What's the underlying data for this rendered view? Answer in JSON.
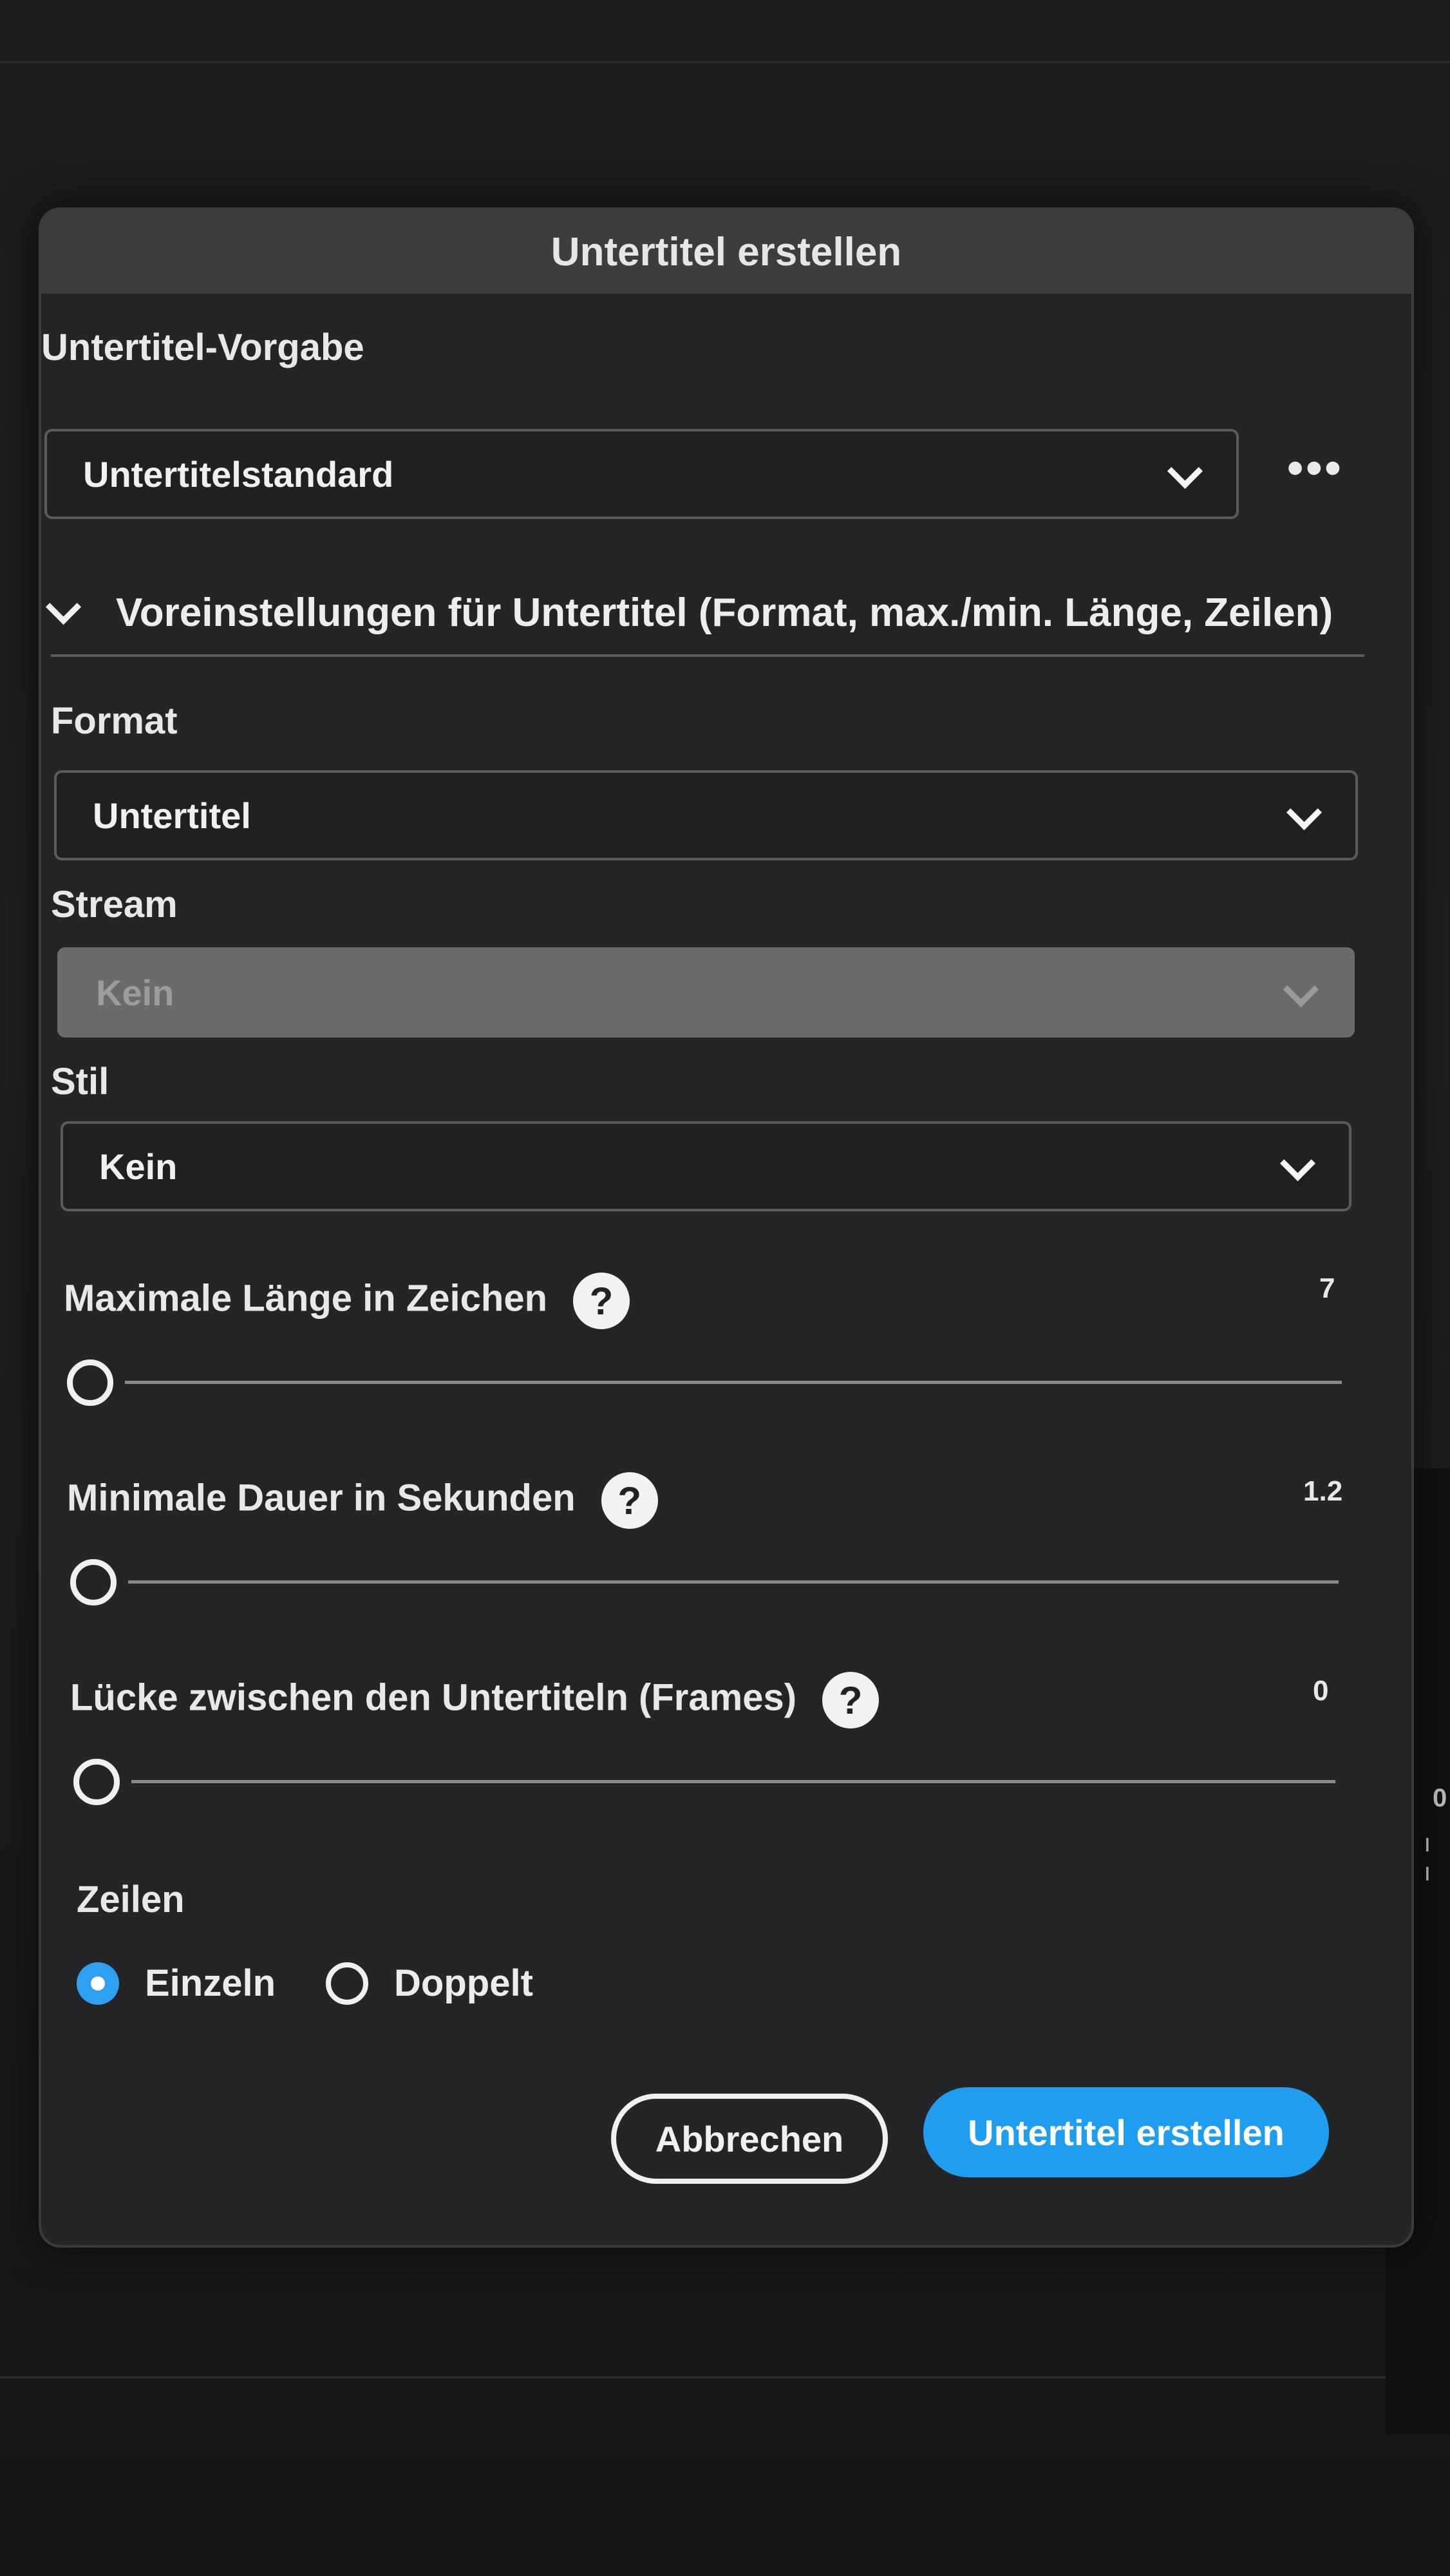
{
  "dialog": {
    "title": "Untertitel erstellen"
  },
  "preset": {
    "label": "Untertitel-Vorgabe",
    "value": "Untertitelstandard",
    "more_label": "•••"
  },
  "section": {
    "title": "Voreinstellungen für Untertitel (Format, max./min. Länge, Zeilen)"
  },
  "format": {
    "label": "Format",
    "value": "Untertitel"
  },
  "stream": {
    "label": "Stream",
    "value": "Kein",
    "disabled": true
  },
  "style": {
    "label": "Stil",
    "value": "Kein"
  },
  "sliders": {
    "max_length": {
      "label": "Maximale Länge in Zeichen",
      "value": "7",
      "help": "?"
    },
    "min_duration": {
      "label": "Minimale Dauer in Sekunden",
      "value": "1.2",
      "help": "?"
    },
    "gap": {
      "label": "Lücke zwischen den Untertiteln (Frames)",
      "value": "0",
      "help": "?"
    }
  },
  "lines": {
    "label": "Zeilen",
    "options": [
      {
        "label": "Einzeln",
        "selected": true
      },
      {
        "label": "Doppelt",
        "selected": false
      }
    ]
  },
  "buttons": {
    "cancel": "Abbrechen",
    "create": "Untertitel erstellen"
  },
  "background": {
    "ticks": "ı ı ı ı",
    "edge_digit": "0"
  },
  "colors": {
    "accent": "#1f9ef0",
    "dialog_bg": "#242526",
    "titlebar_bg": "#3c3d3f"
  }
}
